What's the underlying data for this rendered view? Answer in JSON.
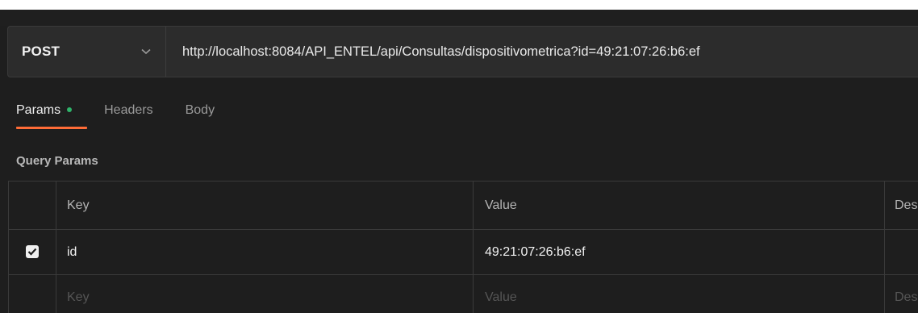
{
  "request": {
    "method": "POST",
    "url": "http://localhost:8084/API_ENTEL/api/Consultas/dispositivometrica?id=49:21:07:26:b6:ef"
  },
  "tabs": [
    {
      "label": "Params",
      "active": true,
      "has_indicator": true
    },
    {
      "label": "Headers",
      "active": false
    },
    {
      "label": "Body",
      "active": false
    }
  ],
  "query_params": {
    "title": "Query Params",
    "headers": {
      "key": "Key",
      "value": "Value",
      "description": "Des"
    },
    "rows": [
      {
        "checked": true,
        "key": "id",
        "value": "49:21:07:26:b6:ef"
      }
    ],
    "placeholders": {
      "key": "Key",
      "value": "Value",
      "description": "Des"
    }
  },
  "colors": {
    "background": "#1e1e1e",
    "accent": "#ff6c37",
    "indicator": "#2fb36a"
  },
  "icons": {
    "method_dropdown": "chevron-down-icon",
    "row_checkbox": "checkmark-icon"
  }
}
